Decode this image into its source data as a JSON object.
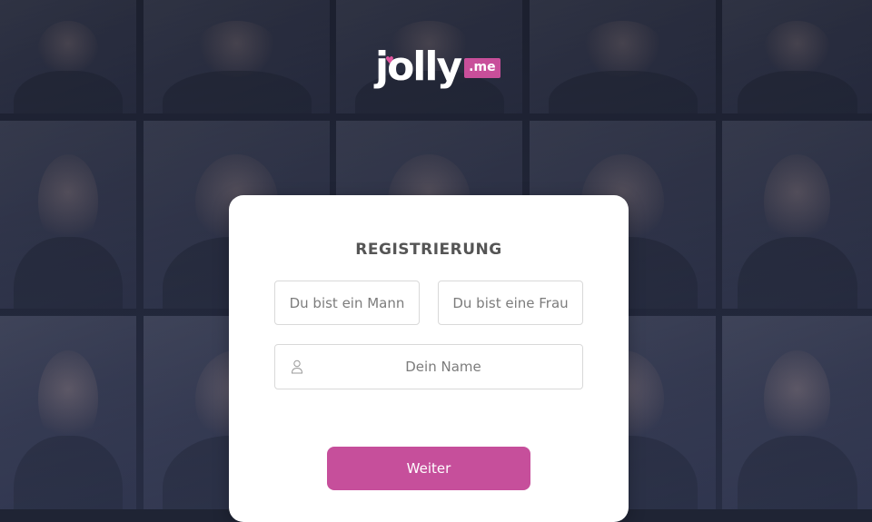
{
  "brand": {
    "logo_word": "jolly",
    "logo_heart": "♥",
    "logo_suffix": ".me",
    "accent_color": "#c64f9b"
  },
  "form": {
    "title": "REGISTRIERUNG",
    "gender_male_label": "Du bist ein Mann",
    "gender_female_label": "Du bist eine Frau",
    "name_placeholder": "Dein Name",
    "name_value": "",
    "name_icon": "user-icon",
    "submit_label": "Weiter"
  }
}
